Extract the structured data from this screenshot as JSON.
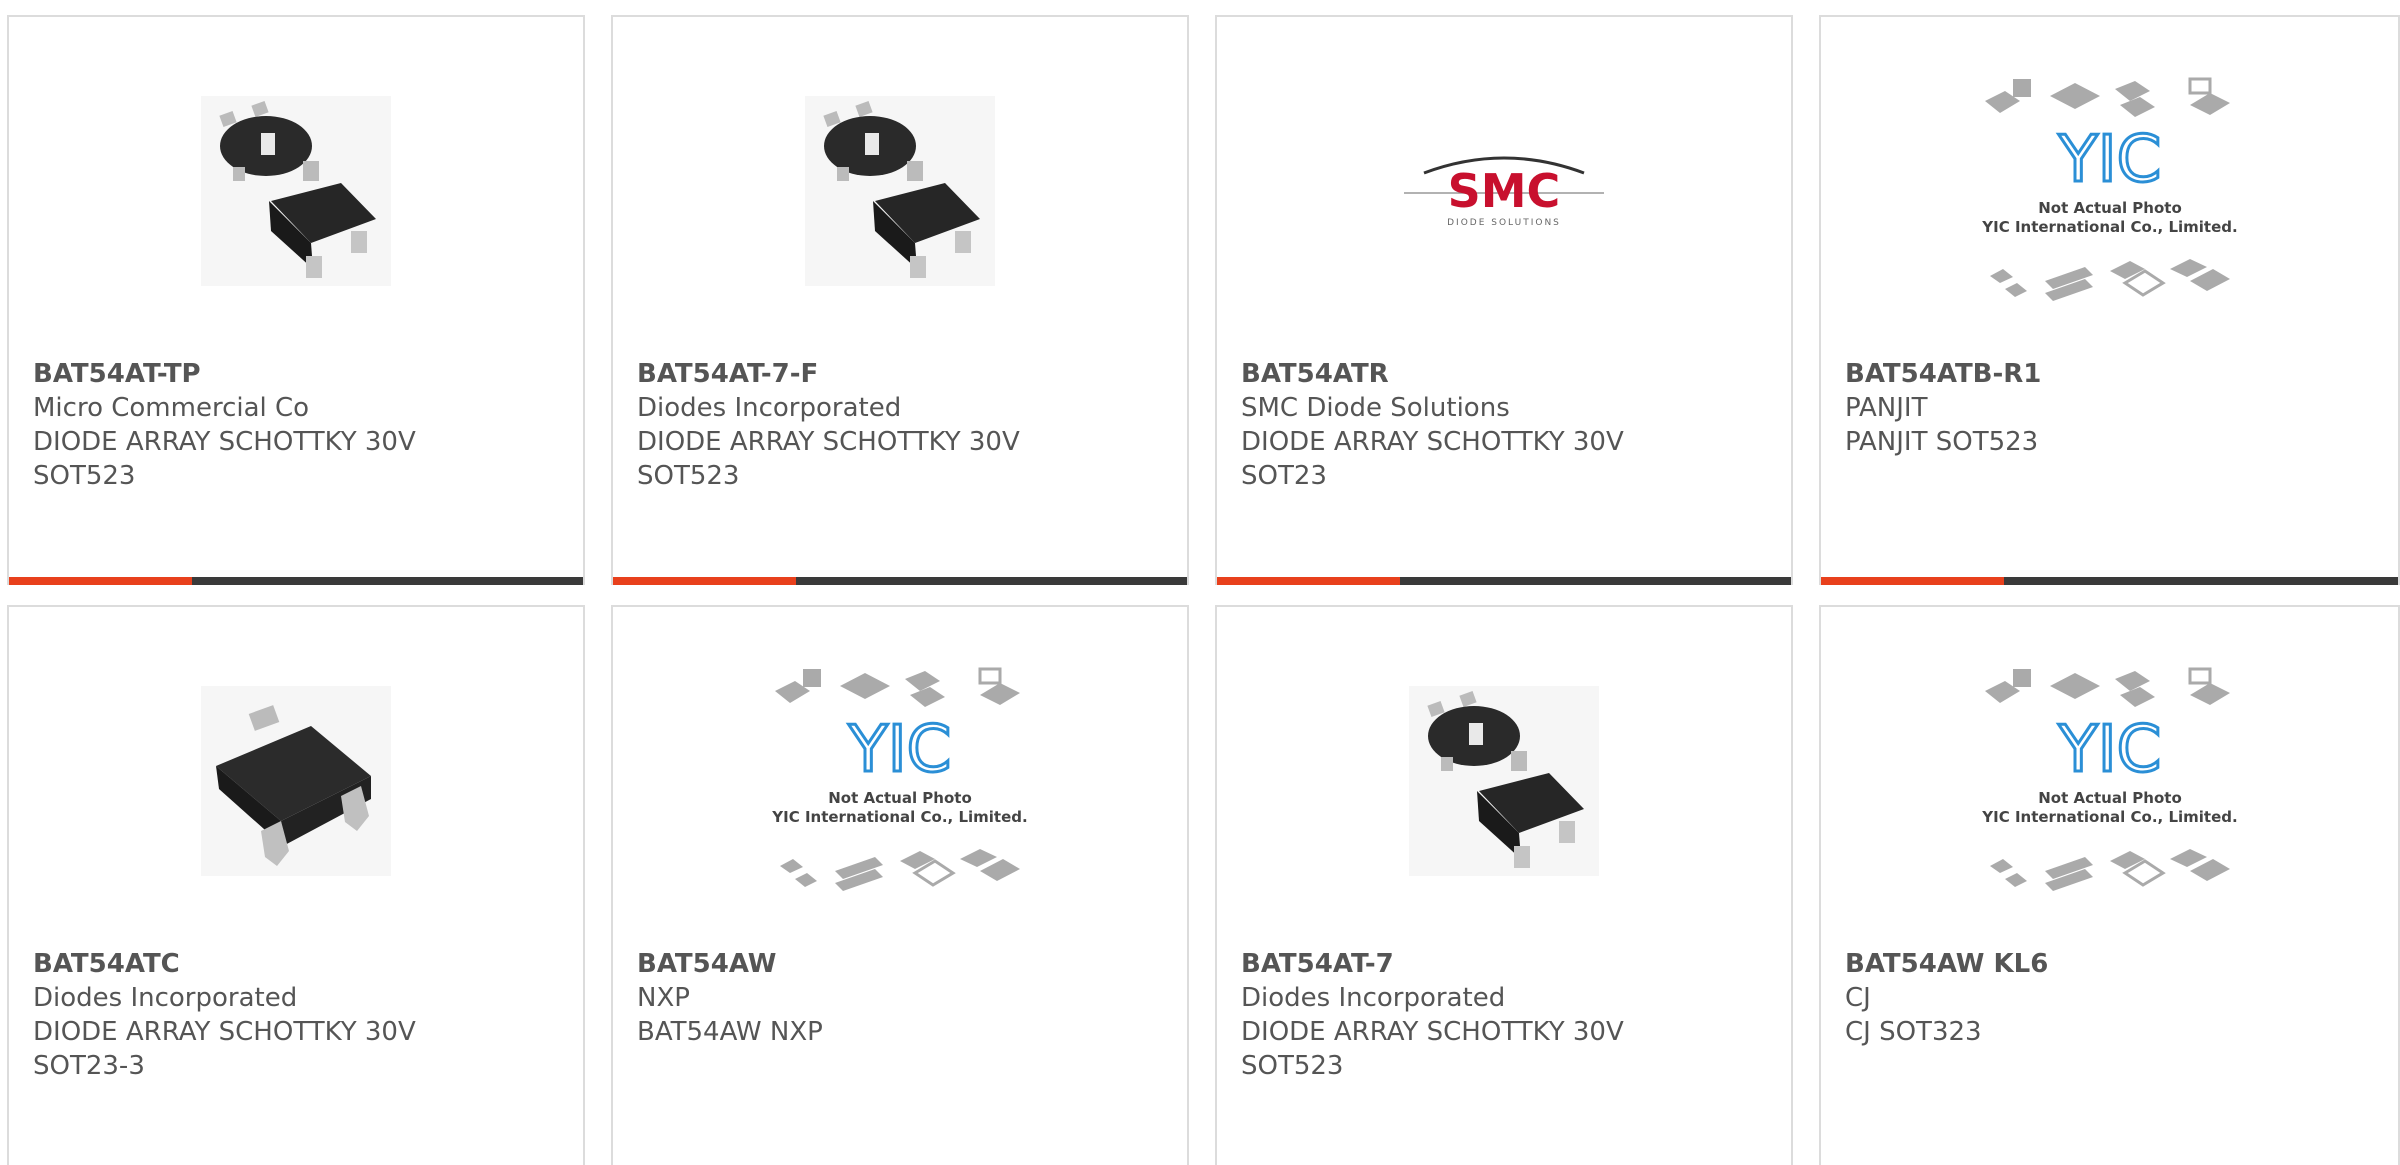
{
  "colors": {
    "accent": "#e8401c",
    "bar": "#3a3a3a",
    "text": "#555555",
    "yic_blue": "#2b8fd6",
    "smc_red": "#c8102e"
  },
  "cards": [
    {
      "part": "BAT54AT-TP",
      "maker": "Micro Commercial Co",
      "desc": "DIODE ARRAY SCHOTTKY 30V",
      "pkg": "SOT523",
      "image": "sot523-package-icon"
    },
    {
      "part": "BAT54AT-7-F",
      "maker": "Diodes Incorporated",
      "desc": "DIODE ARRAY SCHOTTKY 30V",
      "pkg": "SOT523",
      "image": "sot523-package-icon"
    },
    {
      "part": "BAT54ATR",
      "maker": "SMC Diode Solutions",
      "desc": "DIODE ARRAY SCHOTTKY 30V",
      "pkg": "SOT23",
      "image": "smc-logo",
      "logo_text": "SMC",
      "logo_sub": "DIODE SOLUTIONS"
    },
    {
      "part": "BAT54ATB-R1",
      "maker": "PANJIT",
      "desc": "PANJIT SOT523",
      "image": "yic-placeholder",
      "logo_text": "YIC",
      "note1": "Not Actual Photo",
      "note2": "YIC International Co., Limited."
    },
    {
      "part": "BAT54ATC",
      "maker": "Diodes Incorporated",
      "desc": "DIODE ARRAY SCHOTTKY 30V",
      "pkg": "SOT23-3",
      "image": "sot23-package-icon"
    },
    {
      "part": "BAT54AW",
      "maker": "NXP",
      "desc": "BAT54AW NXP",
      "image": "yic-placeholder",
      "logo_text": "YIC",
      "note1": "Not Actual Photo",
      "note2": "YIC International Co., Limited."
    },
    {
      "part": "BAT54AT-7",
      "maker": "Diodes Incorporated",
      "desc": "DIODE ARRAY SCHOTTKY 30V",
      "pkg": "SOT523",
      "image": "sot523-package-icon"
    },
    {
      "part": "BAT54AW KL6",
      "maker": "CJ",
      "desc": "CJ SOT323",
      "image": "yic-placeholder",
      "logo_text": "YIC",
      "note1": "Not Actual Photo",
      "note2": "YIC International Co., Limited."
    }
  ]
}
